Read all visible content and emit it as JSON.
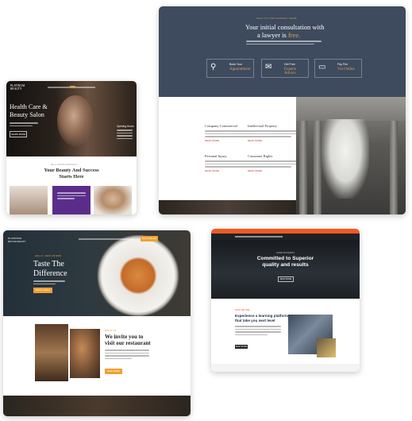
{
  "lawyer": {
    "eyebrow": "TALK TO OUR EXPERT TEAM",
    "headline_1": "Your initial consultation with",
    "headline_2": "a lawyer is ",
    "headline_free": "free.",
    "features": [
      {
        "icon": "person-icon",
        "small": "Book Your",
        "big": "Appointment"
      },
      {
        "icon": "chat-icon",
        "small": "Get Free",
        "big": "Experts Advice"
      },
      {
        "icon": "laptop-icon",
        "small": "Pay Fee",
        "big": "Via Online"
      }
    ],
    "services": [
      {
        "title": "Company Commercial",
        "more": "READ MORE"
      },
      {
        "title": "Intellectual Property",
        "more": "READ MORE"
      },
      {
        "title": "Personal Injury",
        "more": "READ MORE"
      },
      {
        "title": "Consumer Rights",
        "more": "READ MORE"
      }
    ],
    "colors": {
      "hero": "#3e4a5e",
      "accent": "#d8a558"
    }
  },
  "beauty": {
    "logo_1": "PLATINUM",
    "logo_2": "BEAUTY",
    "headline_1": "Health Care &",
    "headline_2": "Beauty Salon",
    "button": "LEARN MORE",
    "eyebrow": "BE A MORE PERFECT",
    "section_1": "Your Beauty And Success",
    "section_2": "Starts Here",
    "hours_title": "Opening Hours",
    "colors": {
      "accent": "#6b3fa0"
    }
  },
  "restaurant": {
    "logo_1": "PLATINUM",
    "logo_2": "RESTAURANT",
    "eyebrow": "HELLO, NEW FRIEND",
    "headline_1": "Taste The",
    "headline_2": "Difference",
    "button": "BOOK A TABLE",
    "reserve": "BOOK ONLINE",
    "about_eyebrow": "ABOUT US",
    "about_1": "We invite you to",
    "about_2": "visit our restaurant",
    "about_button": "READ MORE",
    "colors": {
      "accent": "#f0a030"
    }
  },
  "corporate": {
    "eyebrow": "HOME BUSINESS",
    "headline_1": "Committed to Superior",
    "headline_2": "quality and results",
    "button": "READ MORE",
    "eyebrow_2": "WHO WE ARE",
    "sub_1": "Experience a learning platform",
    "sub_2": "that take you next level",
    "cta": "READ MORE",
    "colors": {
      "accent": "#f15a22"
    }
  }
}
